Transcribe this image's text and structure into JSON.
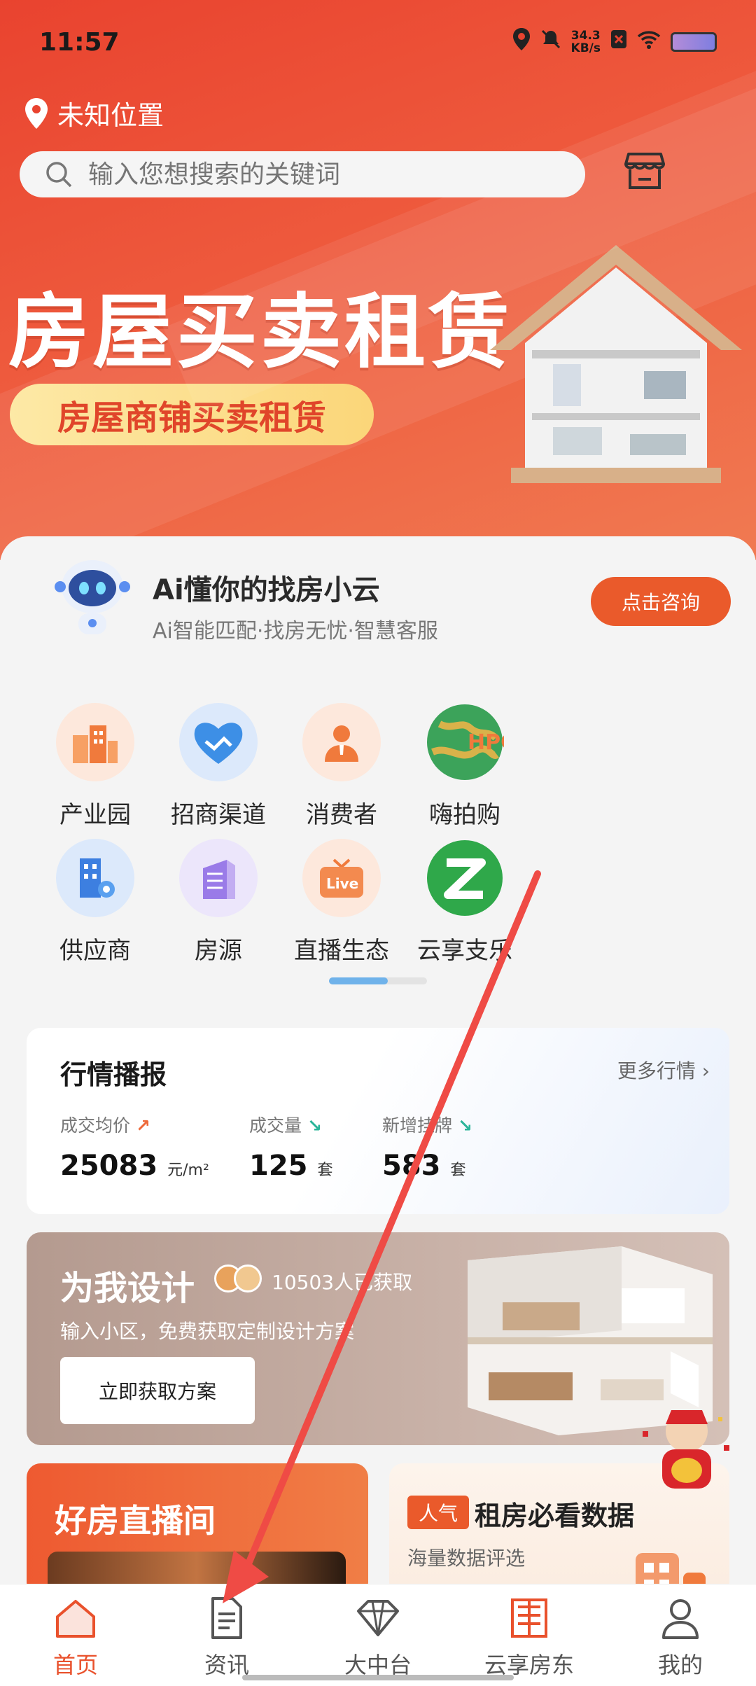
{
  "status_bar": {
    "time": "11:57",
    "speed_value": "34.3",
    "speed_unit": "KB/s"
  },
  "header": {
    "location": "未知位置",
    "search_placeholder": "输入您想搜索的关键词"
  },
  "banner": {
    "title": "房屋买卖租赁",
    "subtitle": "房屋商铺买卖租赁"
  },
  "ai": {
    "title": "Ai懂你的找房小云",
    "subtitle": "Ai智能匹配·找房无忧·智慧客服",
    "button": "点击咨询"
  },
  "categories": [
    {
      "label": "产业园",
      "icon": "buildings-icon",
      "color": "#f28a4c"
    },
    {
      "label": "招商渠道",
      "icon": "handshake-heart-icon",
      "color": "#3d8fe6"
    },
    {
      "label": "消费者",
      "icon": "person-icon",
      "color": "#f0884f"
    },
    {
      "label": "嗨拍购",
      "icon": "globe-hpg-icon",
      "color": "#3ca35a"
    },
    {
      "label": "供应商",
      "icon": "building-gear-icon",
      "color": "#3d7fe0"
    },
    {
      "label": "房源",
      "icon": "building-stack-icon",
      "color": "#9a7be8"
    },
    {
      "label": "直播生态",
      "icon": "live-tv-icon",
      "color": "#f0884f"
    },
    {
      "label": "云享支乐",
      "icon": "green-z-logo-icon",
      "color": "#2fa84a"
    }
  ],
  "market": {
    "title": "行情播报",
    "more": "更多行情",
    "stats": [
      {
        "label": "成交均价",
        "value": "25083",
        "unit": "元/m²",
        "trend": "up"
      },
      {
        "label": "成交量",
        "value": "125",
        "unit": "套",
        "trend": "down"
      },
      {
        "label": "新增挂牌",
        "value": "583",
        "unit": "套",
        "trend": "down"
      }
    ]
  },
  "design": {
    "title": "为我设计",
    "count": "10503人已获取",
    "subtitle": "输入小区，免费获取定制设计方案",
    "button": "立即获取方案"
  },
  "live": {
    "title": "好房直播间"
  },
  "rent": {
    "tag": "人气",
    "title": "租房必看数据",
    "subtitle": "海量数据评选"
  },
  "tabs": [
    {
      "label": "首页",
      "icon": "home-icon",
      "active": true
    },
    {
      "label": "资讯",
      "icon": "document-icon",
      "active": false
    },
    {
      "label": "大中台",
      "icon": "diamond-icon",
      "active": false
    },
    {
      "label": "云享房东",
      "icon": "landlord-logo-icon",
      "active": false
    },
    {
      "label": "我的",
      "icon": "user-icon",
      "active": false
    }
  ],
  "colors": {
    "brand": "#e9512c",
    "accent_blue": "#6fb2ea"
  }
}
